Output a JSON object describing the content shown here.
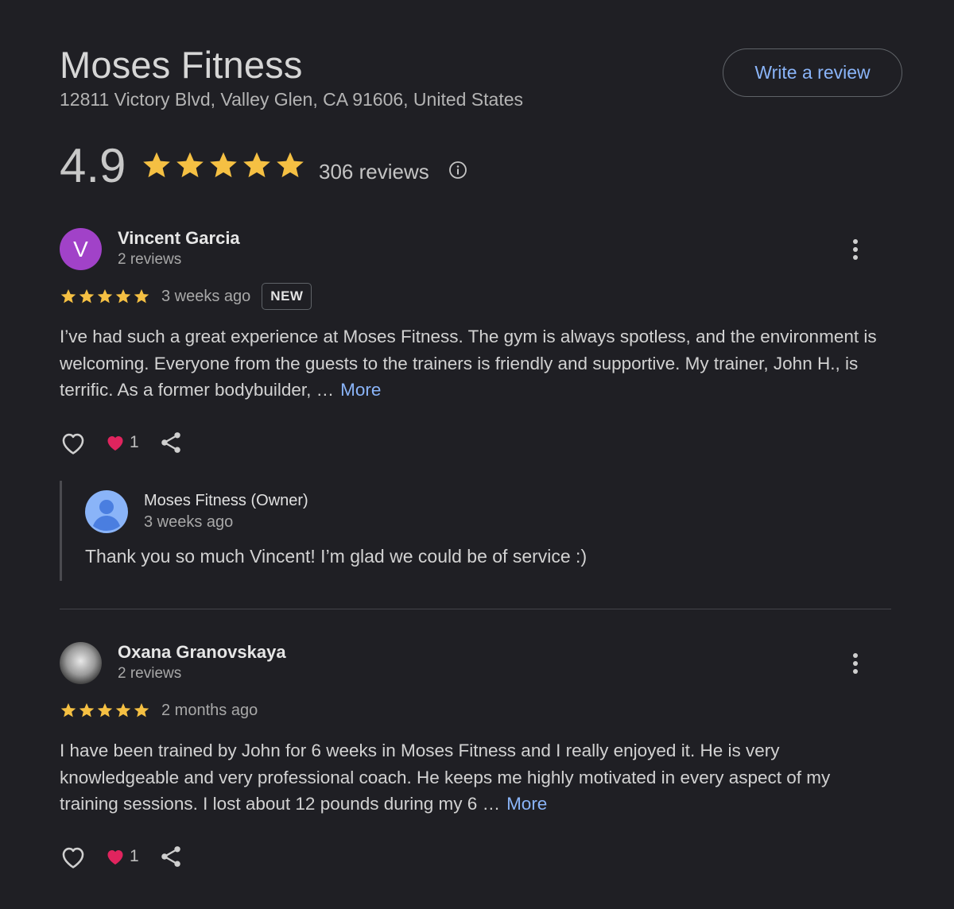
{
  "business": {
    "name": "Moses Fitness",
    "address": "12811 Victory Blvd, Valley Glen, CA 91606, United States",
    "write_review_label": "Write a review",
    "rating": "4.9",
    "stars": 5,
    "review_count": "306 reviews"
  },
  "colors": {
    "star": "#f5c043",
    "link": "#8ab4f8",
    "avatar_v": "#a142c8",
    "owner_avatar": "#8ab4f8",
    "heart": "#e0245e"
  },
  "reviews": [
    {
      "avatar_letter": "V",
      "name": "Vincent Garcia",
      "meta": "2 reviews",
      "stars": 5,
      "time": "3 weeks ago",
      "badge": "NEW",
      "text": "I’ve had such a great experience at Moses Fitness. The gym is always spotless, and the environment is welcoming. Everyone from the guests to the trainers is friendly and supportive. My trainer, John H., is terrific. As a former bodybuilder, …",
      "more_label": "More",
      "reaction_count": "1",
      "owner_reply": {
        "name": "Moses Fitness (Owner)",
        "time": "3 weeks ago",
        "text": "Thank you so much Vincent! I’m glad we could be of service :)"
      }
    },
    {
      "name": "Oxana Granovskaya",
      "meta": "2 reviews",
      "stars": 5,
      "time": "2 months ago",
      "text": "I have been trained by John for 6 weeks in Moses Fitness and I really enjoyed it. He is very knowledgeable and very professional coach. He keeps me highly motivated in every aspect of my training sessions. I lost about 12 pounds during my 6 …",
      "more_label": "More",
      "reaction_count": "1"
    }
  ],
  "icons": {
    "info": "info-icon",
    "kebab": "more-vert-icon",
    "like": "heart-outline-icon",
    "reaction": "red-heart-icon",
    "share": "share-icon",
    "star": "star-icon"
  }
}
